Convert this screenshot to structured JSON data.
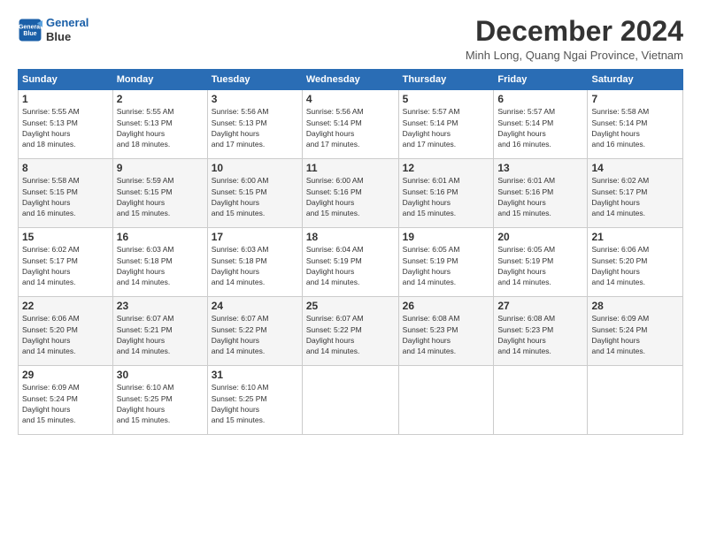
{
  "logo": {
    "line1": "General",
    "line2": "Blue"
  },
  "title": "December 2024",
  "location": "Minh Long, Quang Ngai Province, Vietnam",
  "days_header": [
    "Sunday",
    "Monday",
    "Tuesday",
    "Wednesday",
    "Thursday",
    "Friday",
    "Saturday"
  ],
  "weeks": [
    [
      {
        "day": "1",
        "sunrise": "5:55 AM",
        "sunset": "5:13 PM",
        "daylight": "11 hours and 18 minutes."
      },
      {
        "day": "2",
        "sunrise": "5:55 AM",
        "sunset": "5:13 PM",
        "daylight": "11 hours and 18 minutes."
      },
      {
        "day": "3",
        "sunrise": "5:56 AM",
        "sunset": "5:13 PM",
        "daylight": "11 hours and 17 minutes."
      },
      {
        "day": "4",
        "sunrise": "5:56 AM",
        "sunset": "5:14 PM",
        "daylight": "11 hours and 17 minutes."
      },
      {
        "day": "5",
        "sunrise": "5:57 AM",
        "sunset": "5:14 PM",
        "daylight": "11 hours and 17 minutes."
      },
      {
        "day": "6",
        "sunrise": "5:57 AM",
        "sunset": "5:14 PM",
        "daylight": "11 hours and 16 minutes."
      },
      {
        "day": "7",
        "sunrise": "5:58 AM",
        "sunset": "5:14 PM",
        "daylight": "11 hours and 16 minutes."
      }
    ],
    [
      {
        "day": "8",
        "sunrise": "5:58 AM",
        "sunset": "5:15 PM",
        "daylight": "11 hours and 16 minutes."
      },
      {
        "day": "9",
        "sunrise": "5:59 AM",
        "sunset": "5:15 PM",
        "daylight": "11 hours and 15 minutes."
      },
      {
        "day": "10",
        "sunrise": "6:00 AM",
        "sunset": "5:15 PM",
        "daylight": "11 hours and 15 minutes."
      },
      {
        "day": "11",
        "sunrise": "6:00 AM",
        "sunset": "5:16 PM",
        "daylight": "11 hours and 15 minutes."
      },
      {
        "day": "12",
        "sunrise": "6:01 AM",
        "sunset": "5:16 PM",
        "daylight": "11 hours and 15 minutes."
      },
      {
        "day": "13",
        "sunrise": "6:01 AM",
        "sunset": "5:16 PM",
        "daylight": "11 hours and 15 minutes."
      },
      {
        "day": "14",
        "sunrise": "6:02 AM",
        "sunset": "5:17 PM",
        "daylight": "11 hours and 14 minutes."
      }
    ],
    [
      {
        "day": "15",
        "sunrise": "6:02 AM",
        "sunset": "5:17 PM",
        "daylight": "11 hours and 14 minutes."
      },
      {
        "day": "16",
        "sunrise": "6:03 AM",
        "sunset": "5:18 PM",
        "daylight": "11 hours and 14 minutes."
      },
      {
        "day": "17",
        "sunrise": "6:03 AM",
        "sunset": "5:18 PM",
        "daylight": "11 hours and 14 minutes."
      },
      {
        "day": "18",
        "sunrise": "6:04 AM",
        "sunset": "5:19 PM",
        "daylight": "11 hours and 14 minutes."
      },
      {
        "day": "19",
        "sunrise": "6:05 AM",
        "sunset": "5:19 PM",
        "daylight": "11 hours and 14 minutes."
      },
      {
        "day": "20",
        "sunrise": "6:05 AM",
        "sunset": "5:19 PM",
        "daylight": "11 hours and 14 minutes."
      },
      {
        "day": "21",
        "sunrise": "6:06 AM",
        "sunset": "5:20 PM",
        "daylight": "11 hours and 14 minutes."
      }
    ],
    [
      {
        "day": "22",
        "sunrise": "6:06 AM",
        "sunset": "5:20 PM",
        "daylight": "11 hours and 14 minutes."
      },
      {
        "day": "23",
        "sunrise": "6:07 AM",
        "sunset": "5:21 PM",
        "daylight": "11 hours and 14 minutes."
      },
      {
        "day": "24",
        "sunrise": "6:07 AM",
        "sunset": "5:22 PM",
        "daylight": "11 hours and 14 minutes."
      },
      {
        "day": "25",
        "sunrise": "6:07 AM",
        "sunset": "5:22 PM",
        "daylight": "11 hours and 14 minutes."
      },
      {
        "day": "26",
        "sunrise": "6:08 AM",
        "sunset": "5:23 PM",
        "daylight": "11 hours and 14 minutes."
      },
      {
        "day": "27",
        "sunrise": "6:08 AM",
        "sunset": "5:23 PM",
        "daylight": "11 hours and 14 minutes."
      },
      {
        "day": "28",
        "sunrise": "6:09 AM",
        "sunset": "5:24 PM",
        "daylight": "11 hours and 14 minutes."
      }
    ],
    [
      {
        "day": "29",
        "sunrise": "6:09 AM",
        "sunset": "5:24 PM",
        "daylight": "11 hours and 15 minutes."
      },
      {
        "day": "30",
        "sunrise": "6:10 AM",
        "sunset": "5:25 PM",
        "daylight": "11 hours and 15 minutes."
      },
      {
        "day": "31",
        "sunrise": "6:10 AM",
        "sunset": "5:25 PM",
        "daylight": "11 hours and 15 minutes."
      },
      null,
      null,
      null,
      null
    ]
  ]
}
